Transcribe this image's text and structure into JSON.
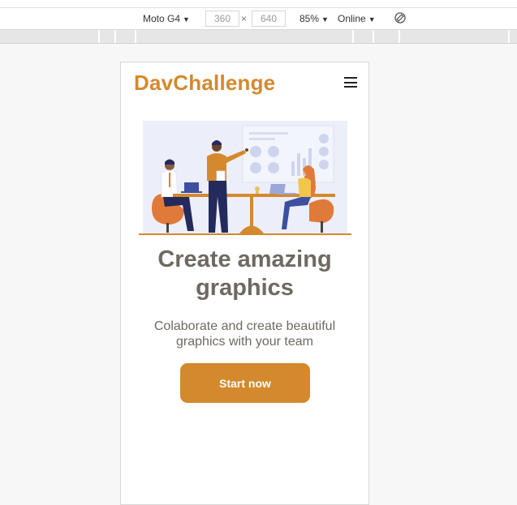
{
  "devtools": {
    "device": "Moto G4",
    "width": "360",
    "height": "640",
    "zoom": "85%",
    "network": "Online",
    "times_symbol": "×",
    "caret": "▼",
    "rotate_icon": "rotate-icon"
  },
  "site": {
    "logo": "DavChallenge",
    "menu_icon": "hamburger-menu-icon",
    "hero_illustration": "team-meeting-illustration",
    "headline_line1": "Create amazing",
    "headline_line2": "graphics",
    "subtext_line1": "Colaborate and create beautiful",
    "subtext_line2": "graphics with your team",
    "cta_label": "Start now"
  },
  "colors": {
    "brand": "#d4892d",
    "text": "#6e6961",
    "illustration_bg": "#eceff9",
    "figure_navy": "#252a5c"
  }
}
